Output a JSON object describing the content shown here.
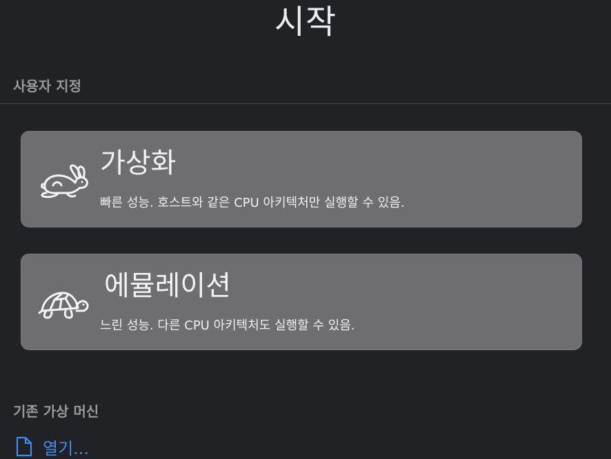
{
  "header": {
    "title": "시작"
  },
  "sections": {
    "custom": "사용자 지정",
    "existing": "기존 가상 머신"
  },
  "options": {
    "virtualize": {
      "title": "가상화",
      "description": "빠른 성능. 호스트와 같은 CPU 아키텍처만 실행할 수 있음.",
      "icon": "rabbit-icon"
    },
    "emulate": {
      "title": "에뮬레이션",
      "description": "느린 성능. 다른 CPU 아키텍처도 실행할 수 있음.",
      "icon": "turtle-icon"
    }
  },
  "open": {
    "label": "열기...",
    "icon": "document-icon"
  },
  "colors": {
    "background": "#212226",
    "card": "#6e6e70",
    "link": "#3b8ef0",
    "section_header": "#9a9a9e"
  }
}
